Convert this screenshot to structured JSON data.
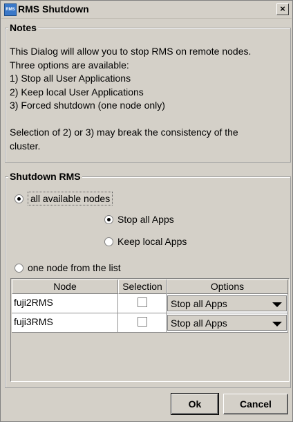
{
  "window": {
    "title": "RMS Shutdown",
    "icon_label": "RMS",
    "close_glyph": "×"
  },
  "notes": {
    "title": "Notes",
    "lines": [
      "This Dialog will allow you to stop RMS on remote nodes.",
      "Three options are available:",
      "1) Stop all User Applications",
      "2) Keep local User Applications",
      "3) Forced shutdown (one node only)",
      "",
      "Selection of 2) or 3) may break the consistency of the",
      "cluster."
    ]
  },
  "shutdown": {
    "title": "Shutdown RMS",
    "all_nodes_label": "all available nodes",
    "stop_all_label": "Stop all Apps",
    "keep_local_label": "Keep local Apps",
    "one_node_label": "one node from the list",
    "selected_scope": "all available nodes",
    "selected_mode": "Stop all Apps"
  },
  "table": {
    "headers": [
      "Node",
      "Selection",
      "Options"
    ],
    "rows": [
      {
        "node": "fuji2RMS",
        "selected": false,
        "option": "Stop all Apps"
      },
      {
        "node": "fuji3RMS",
        "selected": false,
        "option": "Stop all Apps"
      }
    ]
  },
  "buttons": {
    "ok": "Ok",
    "cancel": "Cancel"
  }
}
